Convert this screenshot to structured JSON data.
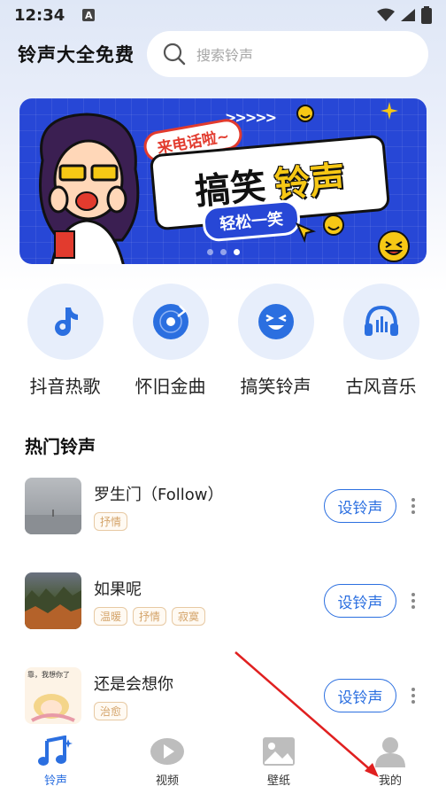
{
  "status_bar": {
    "time": "12:34",
    "notification_icon": "A"
  },
  "header": {
    "app_title": "铃声大全免费",
    "search_placeholder": "搜索铃声"
  },
  "banner": {
    "bubble_small": "来电话啦~",
    "title_part1": "搞笑",
    "title_part2": "铃声",
    "tag": "轻松一笑",
    "dots": 3,
    "active_dot": 3
  },
  "categories": [
    {
      "label": "抖音热歌",
      "icon": "tiktok-note-icon"
    },
    {
      "label": "怀旧金曲",
      "icon": "vinyl-record-icon"
    },
    {
      "label": "搞笑铃声",
      "icon": "laughing-face-icon"
    },
    {
      "label": "古风音乐",
      "icon": "headphones-music-icon"
    }
  ],
  "hot_section": {
    "title": "热门铃声"
  },
  "songs": [
    {
      "title": "罗生门（Follow）",
      "tags": [
        "抒情"
      ],
      "action": "设铃声"
    },
    {
      "title": "如果呢",
      "tags": [
        "温暖",
        "抒情",
        "寂寞"
      ],
      "action": "设铃声"
    },
    {
      "title": "还是会想你",
      "tags": [
        "治愈"
      ],
      "action": "设铃声",
      "thumb_caption": "靠，我想你了"
    }
  ],
  "bottom_nav": [
    {
      "label": "铃声",
      "icon": "music-notes-icon",
      "active": true
    },
    {
      "label": "视频",
      "icon": "video-play-icon",
      "active": false
    },
    {
      "label": "壁纸",
      "icon": "wallpaper-image-icon",
      "active": false
    },
    {
      "label": "我的",
      "icon": "profile-person-icon",
      "active": false
    }
  ],
  "colors": {
    "accent": "#2b6fe0",
    "banner_bg": "#2747d6",
    "tag_text": "#d4a46a",
    "annotation_arrow": "#e02020"
  }
}
